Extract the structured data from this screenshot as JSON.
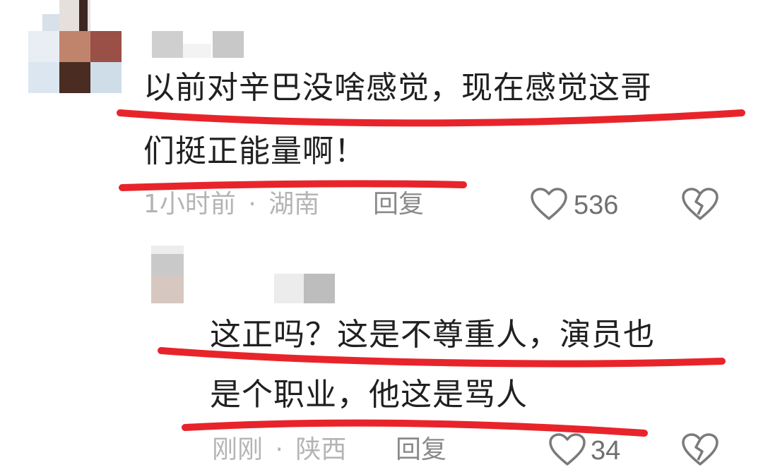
{
  "comments": [
    {
      "line1": "以前对辛巴没啥感觉，现在感觉这哥",
      "line2": "们挺正能量啊！",
      "time": "1小时前",
      "separator": "·",
      "location": "湖南",
      "reply_label": "回复",
      "likes": "536",
      "like_icon": "heart-outline-icon",
      "dislike_icon": "broken-heart-icon"
    },
    {
      "line1": "这正吗？这是不尊重人，演员也",
      "line2": "是个职业，他这是骂人",
      "time": "刚刚",
      "separator": "·",
      "location": "陕西",
      "reply_label": "回复",
      "likes": "34",
      "like_icon": "heart-outline-icon",
      "dislike_icon": "broken-heart-icon"
    }
  ],
  "colors": {
    "underline": "#e8242b",
    "meta_text": "#b4b4b4",
    "reply_text": "#8a8a8a",
    "icon_stroke": "#7a7a7a"
  }
}
